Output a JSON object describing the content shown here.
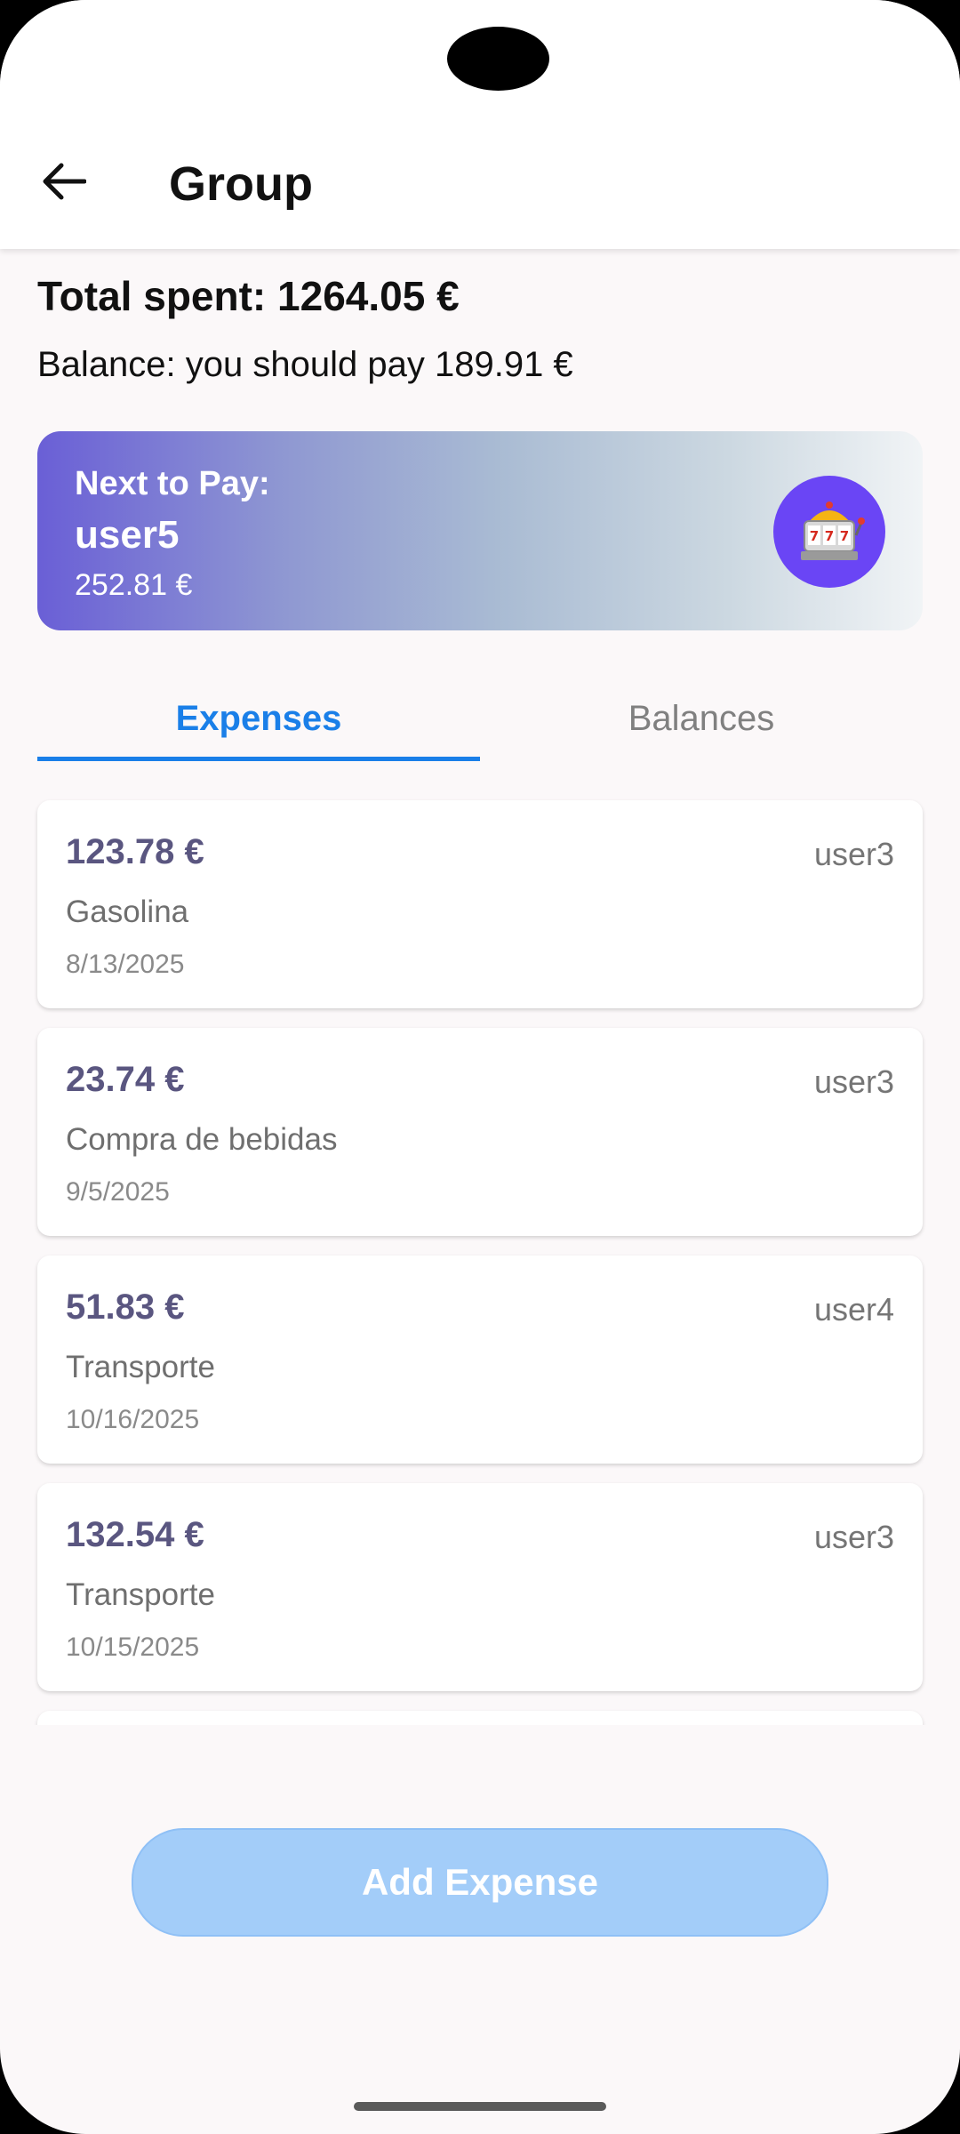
{
  "header": {
    "title": "Group",
    "back_icon": "arrow-left-icon"
  },
  "summary": {
    "total_spent": "Total spent: 1264.05 €",
    "balance": "Balance: you should pay 189.91 €"
  },
  "next_to_pay": {
    "label": "Next to Pay:",
    "user": "user5",
    "amount": "252.81 €",
    "icon": "slot-machine-icon",
    "icon_bg": "#6a45f5"
  },
  "tabs": [
    {
      "label": "Expenses",
      "active": true
    },
    {
      "label": "Balances",
      "active": false
    }
  ],
  "expenses": [
    {
      "amount": "123.78 €",
      "payer": "user3",
      "description": "Gasolina",
      "date": "8/13/2025"
    },
    {
      "amount": "23.74 €",
      "payer": "user3",
      "description": "Compra de bebidas",
      "date": "9/5/2025"
    },
    {
      "amount": "51.83 €",
      "payer": "user4",
      "description": "Transporte",
      "date": "10/16/2025"
    },
    {
      "amount": "132.54 €",
      "payer": "user3",
      "description": "Transporte",
      "date": "10/15/2025"
    }
  ],
  "actions": {
    "add_expense": "Add Expense"
  },
  "colors": {
    "accent": "#1a7fe8",
    "amount_text": "#5a5680",
    "button_disabled": "#a3cdf9"
  }
}
